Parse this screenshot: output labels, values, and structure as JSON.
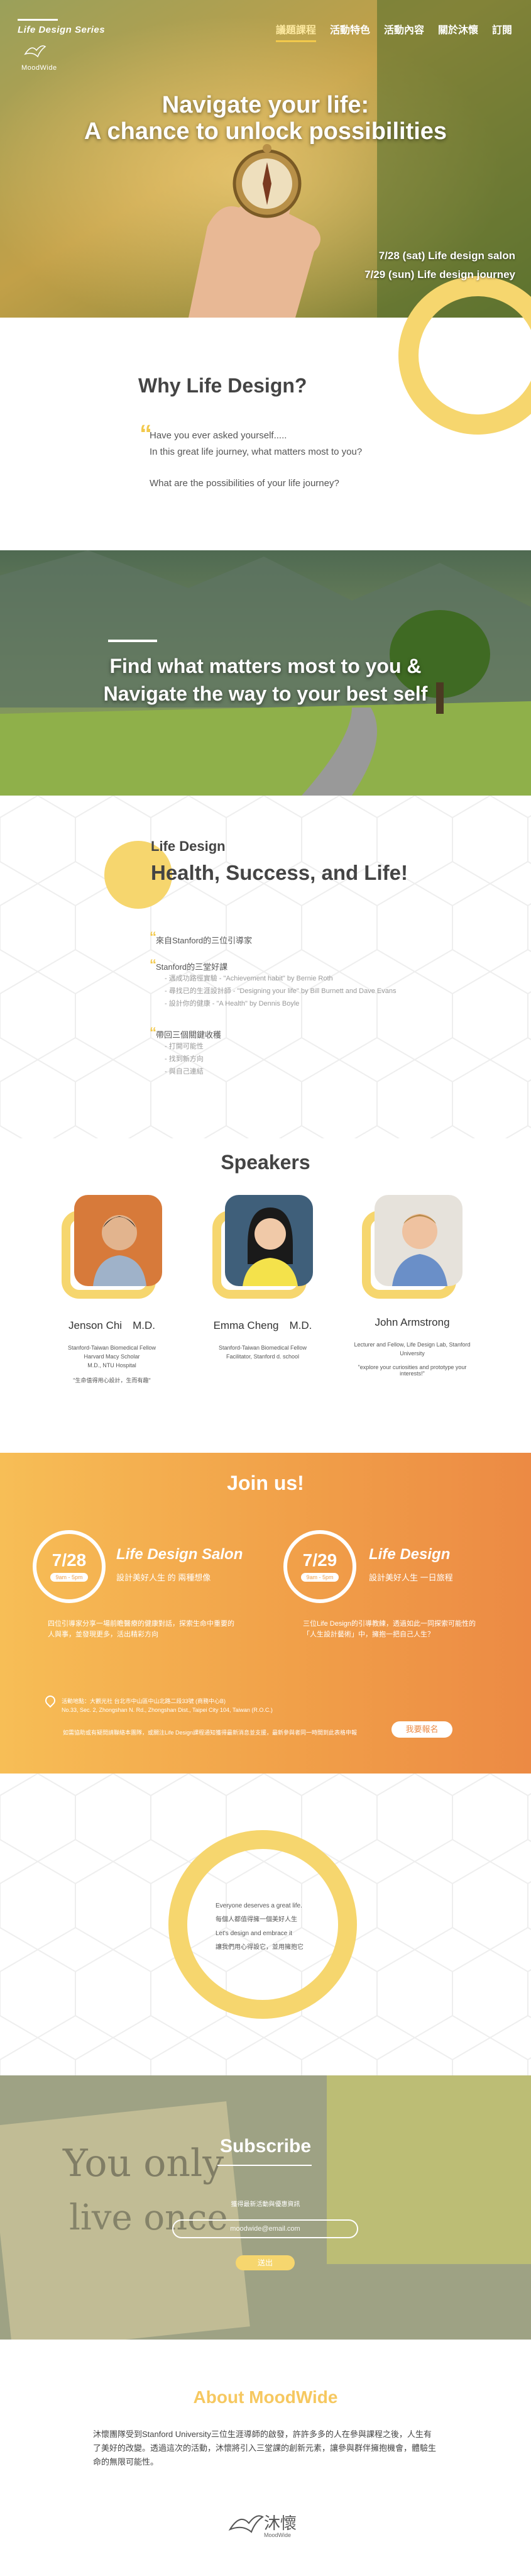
{
  "header": {
    "logo_title": "Life Design Series",
    "logo_sub": "MoodWide",
    "nav": [
      {
        "label": "議題課程",
        "active": true
      },
      {
        "label": "活動特色",
        "active": false
      },
      {
        "label": "活動內容",
        "active": false
      },
      {
        "label": "關於沐懷",
        "active": false
      },
      {
        "label": "訂閱",
        "active": false
      }
    ]
  },
  "hero": {
    "title_line1": "Navigate your life:",
    "title_line2": "A chance to unlock possibilities",
    "date1": "7/28 (sat) Life design salon",
    "date2": "7/29 (sun) Life design journey"
  },
  "why": {
    "title": "Why Life Design?",
    "q1": "Have you ever asked yourself.....",
    "q2": "In this great life journey, what matters most to you?",
    "q3": "What are the possibilities of your life journey?"
  },
  "find": {
    "line1": "Find what matters most to you &",
    "line2": "Navigate the way to your best self"
  },
  "life_design": {
    "small_title": "Life Design",
    "big_title": "Health, Success, and Life!",
    "item1": "來自Stanford的三位引導家",
    "item2": "Stanford的三堂好課",
    "item2_subs": [
      "- 邁成功路徑實驗 - \"Achievement habit\" by Bernie Roth",
      "- 尋找已的生涯設計師 - \"Designing your life\" by Bill Burnett and Dave Evans",
      "- 設計你的健康 - \"A Health\" by Dennis Boyle"
    ],
    "item3": "帶回三個關鍵收穫",
    "item3_subs": [
      "- 打開可能性",
      "- 找到新方向",
      "- 與自己連結"
    ]
  },
  "speakers": {
    "title": "Speakers",
    "list": [
      {
        "name": "Jenson Chi　M.D.",
        "desc": [
          "Stanford-Taiwan Biomedical Fellow",
          "Harvard Macy Scholar",
          "M.D., NTU Hospital"
        ],
        "motto": "\"生命值得用心設計，生而有趣\""
      },
      {
        "name": "Emma Cheng　M.D.",
        "desc": [
          "Stanford-Taiwan Biomedical Fellow",
          "Facilitator, Stanford d. school"
        ],
        "motto": ""
      },
      {
        "name": "John Armstrong",
        "desc": [
          "Lecturer and Fellow, Life Design Lab, Stanford University"
        ],
        "motto": "\"explore your curiosities and prototype your interests!\""
      }
    ]
  },
  "join": {
    "title": "Join us!",
    "events": [
      {
        "date": "7/28",
        "time": "9am - 5pm",
        "name": "Life Design Salon",
        "tag": "設計美好人生 的 兩種想像",
        "desc1": "四位引導家分享一場前瞻醫療的健康對話，探索生命中重要的",
        "desc2": "人與事，並發現更多，活出精彩方向"
      },
      {
        "date": "7/29",
        "time": "9am - 5pm",
        "name": "Life Design",
        "tag": "設計美好人生 一日旅程",
        "desc1": "三位Life Design的引導教練，透過如此一同探索可能性的",
        "desc2": "「人生設計藝術」中，擁抱一把自己人生？"
      }
    ],
    "address1": "活動地點：大觀光社 台北市中山區中山北路二段33號 (商務中心B)",
    "address2": "No.33, Sec. 2, Zhongshan N. Rd., Zhongshan Dist., Taipei City 104, Taiwan (R.O.C.)",
    "note": "如需協助或有疑問請聯絡本團隊，或關注Life Design課程通知獲得最新消息並支援，最新參與者同一時間到此表格申報",
    "register": "我要報名"
  },
  "belief": {
    "lines": [
      "Everyone deserves a great life.",
      "每個人都值得擁一個美好人生",
      "Let's design and embrace it",
      "讓我們用心得設它，並用擁抱它"
    ]
  },
  "subscribe": {
    "title": "Subscribe",
    "label": "獲得最新活動與優惠資訊",
    "placeholder": "moodwide@email.com",
    "button": "送出"
  },
  "about": {
    "title": "About MoodWide",
    "text": "沐懷團隊受到Stanford University三位生涯導師的啟發，許許多多的人在參與課程之後，人生有了美好的改變。透過這次的活動，沐懷將引入三堂課的創新元素，讓參與群伴擁抱機會，體驗生命的無限可能性。",
    "logo_name": "沐懷",
    "logo_en": "MoodWide"
  },
  "colors": {
    "accent": "#f6d66e",
    "orange": "#ec8a44"
  },
  "icons": [
    "compass-photo",
    "location-pin-icon",
    "bird-logo-icon"
  ]
}
